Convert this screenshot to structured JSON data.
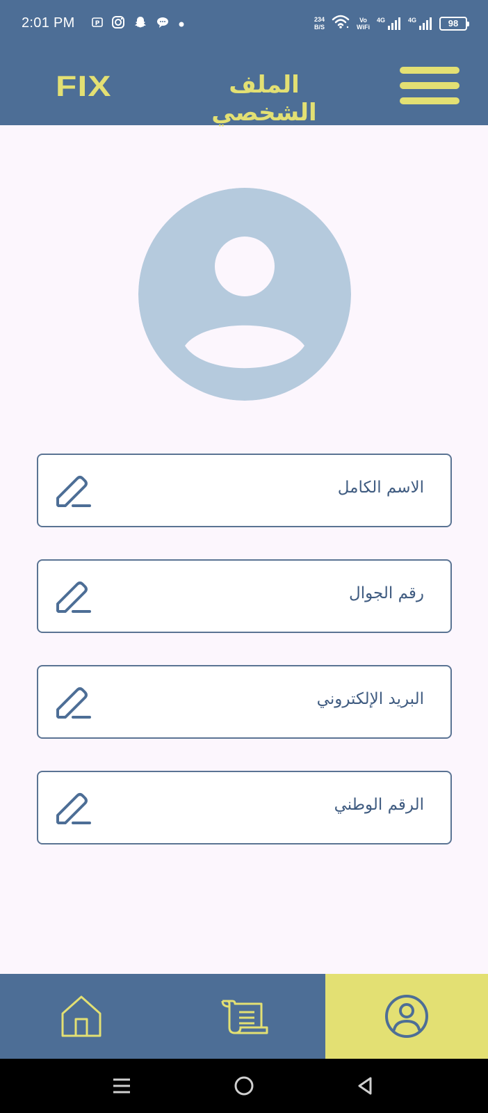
{
  "status_bar": {
    "time": "2:01 PM",
    "net_speed_value": "234",
    "net_speed_unit": "B/S",
    "vowifi_line1": "Vo",
    "vowifi_line2": "WiFi",
    "sim1_network": "4G",
    "sim2_network": "4G",
    "battery_level": "98",
    "notification_icons": [
      "pi-app-icon",
      "instagram-icon",
      "snapchat-icon",
      "chat-bubble-icon",
      "dot-icon"
    ]
  },
  "header": {
    "logo": "FIX",
    "title": "الملف الشخصي",
    "menu_icon": "hamburger-menu-icon"
  },
  "profile": {
    "avatar_icon": "user-avatar-placeholder-icon"
  },
  "fields": [
    {
      "label": "الاسم الكامل",
      "icon": "pencil-edit-icon"
    },
    {
      "label": "رقم الجوال",
      "icon": "pencil-edit-icon"
    },
    {
      "label": "البريد الإلكتروني",
      "icon": "pencil-edit-icon"
    },
    {
      "label": "الرقم الوطني",
      "icon": "pencil-edit-icon"
    }
  ],
  "bottom_nav": {
    "items": [
      {
        "icon": "home-icon",
        "active": false
      },
      {
        "icon": "scroll-orders-icon",
        "active": false
      },
      {
        "icon": "user-profile-icon",
        "active": true
      }
    ]
  },
  "system_nav": {
    "buttons": [
      "recents-icon",
      "home-circle-icon",
      "back-triangle-icon"
    ]
  },
  "colors": {
    "primary": "#4d6e96",
    "accent": "#e3e073",
    "background": "#fcf6fd",
    "avatar": "#b5cadd",
    "field_border": "#5a7393",
    "field_text": "#3f5b80"
  }
}
